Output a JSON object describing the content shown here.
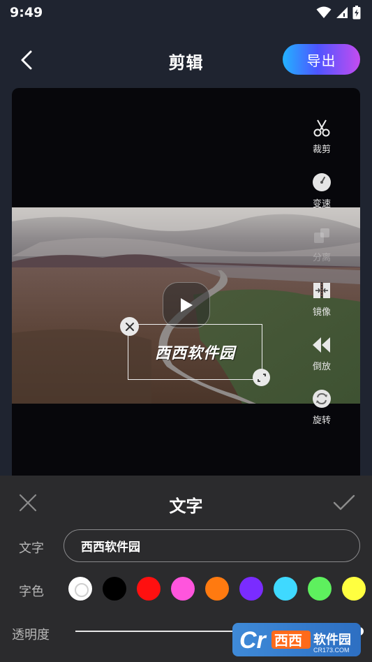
{
  "status_bar": {
    "time": "9:49"
  },
  "header": {
    "title": "剪辑",
    "export_label": "导出"
  },
  "preview": {
    "overlay_text": "西西软件园"
  },
  "tools": [
    {
      "label": "裁剪",
      "icon": "scissors-icon"
    },
    {
      "label": "变速",
      "icon": "speed-dial-icon"
    },
    {
      "label": "分离",
      "icon": "split-icon"
    },
    {
      "label": "镜像",
      "icon": "mirror-icon"
    },
    {
      "label": "倒放",
      "icon": "rewind-icon"
    },
    {
      "label": "旋转",
      "icon": "rotate-icon"
    }
  ],
  "panel": {
    "title": "文字",
    "text_label": "文字",
    "text_value": "西西软件园",
    "color_label": "字色",
    "opacity_label": "透明度",
    "opacity_value": 1.0,
    "colors": [
      "#ffffff",
      "#000000",
      "#ff1010",
      "#ff55dd",
      "#ff7a10",
      "#7a2cff",
      "#3fd9ff",
      "#5ef05e",
      "#ffff40"
    ],
    "selected_color": "#ffffff"
  },
  "watermark": {
    "brand": "西西软件园",
    "site": "CR173.COM"
  }
}
